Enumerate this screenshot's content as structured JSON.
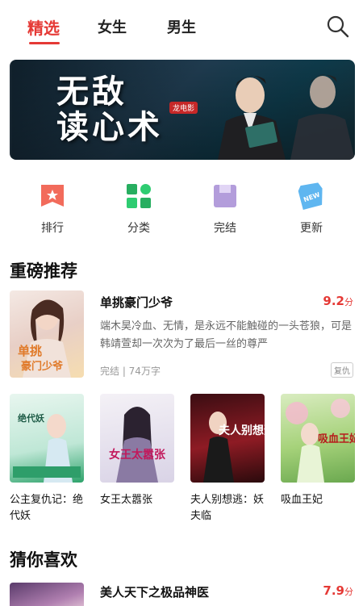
{
  "tabs": [
    {
      "label": "精选",
      "active": true
    },
    {
      "label": "女生",
      "active": false
    },
    {
      "label": "男生",
      "active": false
    }
  ],
  "banner": {
    "title_line1": "无敌",
    "title_line2": "读心术",
    "seal": "龙电影"
  },
  "entries": [
    {
      "label": "排行",
      "icon": "ranking-icon"
    },
    {
      "label": "分类",
      "icon": "category-icon"
    },
    {
      "label": "完结",
      "icon": "completed-icon"
    },
    {
      "label": "更新",
      "icon": "new-icon",
      "badge": "NEW"
    }
  ],
  "sections": {
    "featured": "重磅推荐",
    "guess": "猜你喜欢"
  },
  "featured_book": {
    "title": "单挑豪门少爷",
    "score": "9.2",
    "score_unit": "分",
    "description": "端木昊冷血、无情，是永远不能触碰的一头苍狼，可是韩靖萱却一次次为了最后一丝的尊严",
    "meta": "完结 | 74万字",
    "tag": "复仇",
    "cover_text": "单挑豪门少爷"
  },
  "grid_books": [
    {
      "name": "公主复仇记：绝代妖",
      "cover_text": "绝代妖"
    },
    {
      "name": "女王太嚣张",
      "cover_text": "女王太嚣张"
    },
    {
      "name": "夫人别想逃：妖夫临",
      "cover_text": "夫人别想逃"
    },
    {
      "name": "吸血王妃",
      "cover_text": "吸血王妃"
    }
  ],
  "recommend": {
    "title": "美人天下之极品神医",
    "score": "7.9",
    "score_unit": "分"
  },
  "colors": {
    "accent": "#e53935"
  }
}
